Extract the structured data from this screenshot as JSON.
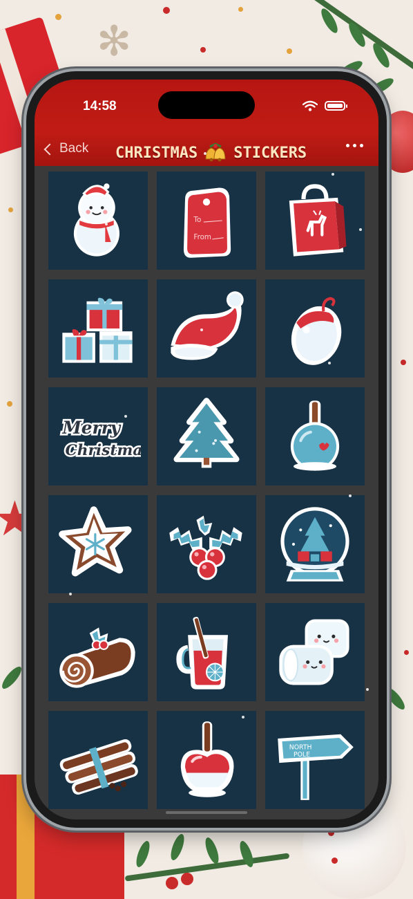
{
  "status_bar": {
    "time": "14:58",
    "icons": [
      "wifi-icon",
      "battery-icon"
    ]
  },
  "nav": {
    "back_label": "Back",
    "title_left": "CHRISTMAS",
    "title_right": "STICKERS",
    "title_icon": "bells-icon",
    "more_icon": "more-icon"
  },
  "colors": {
    "header_red": "#b61612",
    "cell_bg": "#173245",
    "grid_bg": "#3a3a3a",
    "title_color": "#fbe6c2"
  },
  "stickers": [
    {
      "name": "snowman"
    },
    {
      "name": "gift-tag",
      "text_to": "To",
      "text_from": "From"
    },
    {
      "name": "shopping-bag-reindeer"
    },
    {
      "name": "gift-boxes"
    },
    {
      "name": "santa-hat"
    },
    {
      "name": "ornament-hat"
    },
    {
      "name": "merry-christmas-text",
      "line1": "Merry",
      "line2": "Christmas"
    },
    {
      "name": "christmas-tree"
    },
    {
      "name": "candy-apple-blue"
    },
    {
      "name": "gingerbread-star-cookie"
    },
    {
      "name": "holly-berries"
    },
    {
      "name": "snow-globe"
    },
    {
      "name": "yule-log"
    },
    {
      "name": "mulled-wine-glass"
    },
    {
      "name": "marshmallows"
    },
    {
      "name": "cinnamon-sticks"
    },
    {
      "name": "candy-apple-red"
    },
    {
      "name": "north-pole-sign",
      "sign_text1": "NORTH",
      "sign_text2": "POLE"
    }
  ]
}
